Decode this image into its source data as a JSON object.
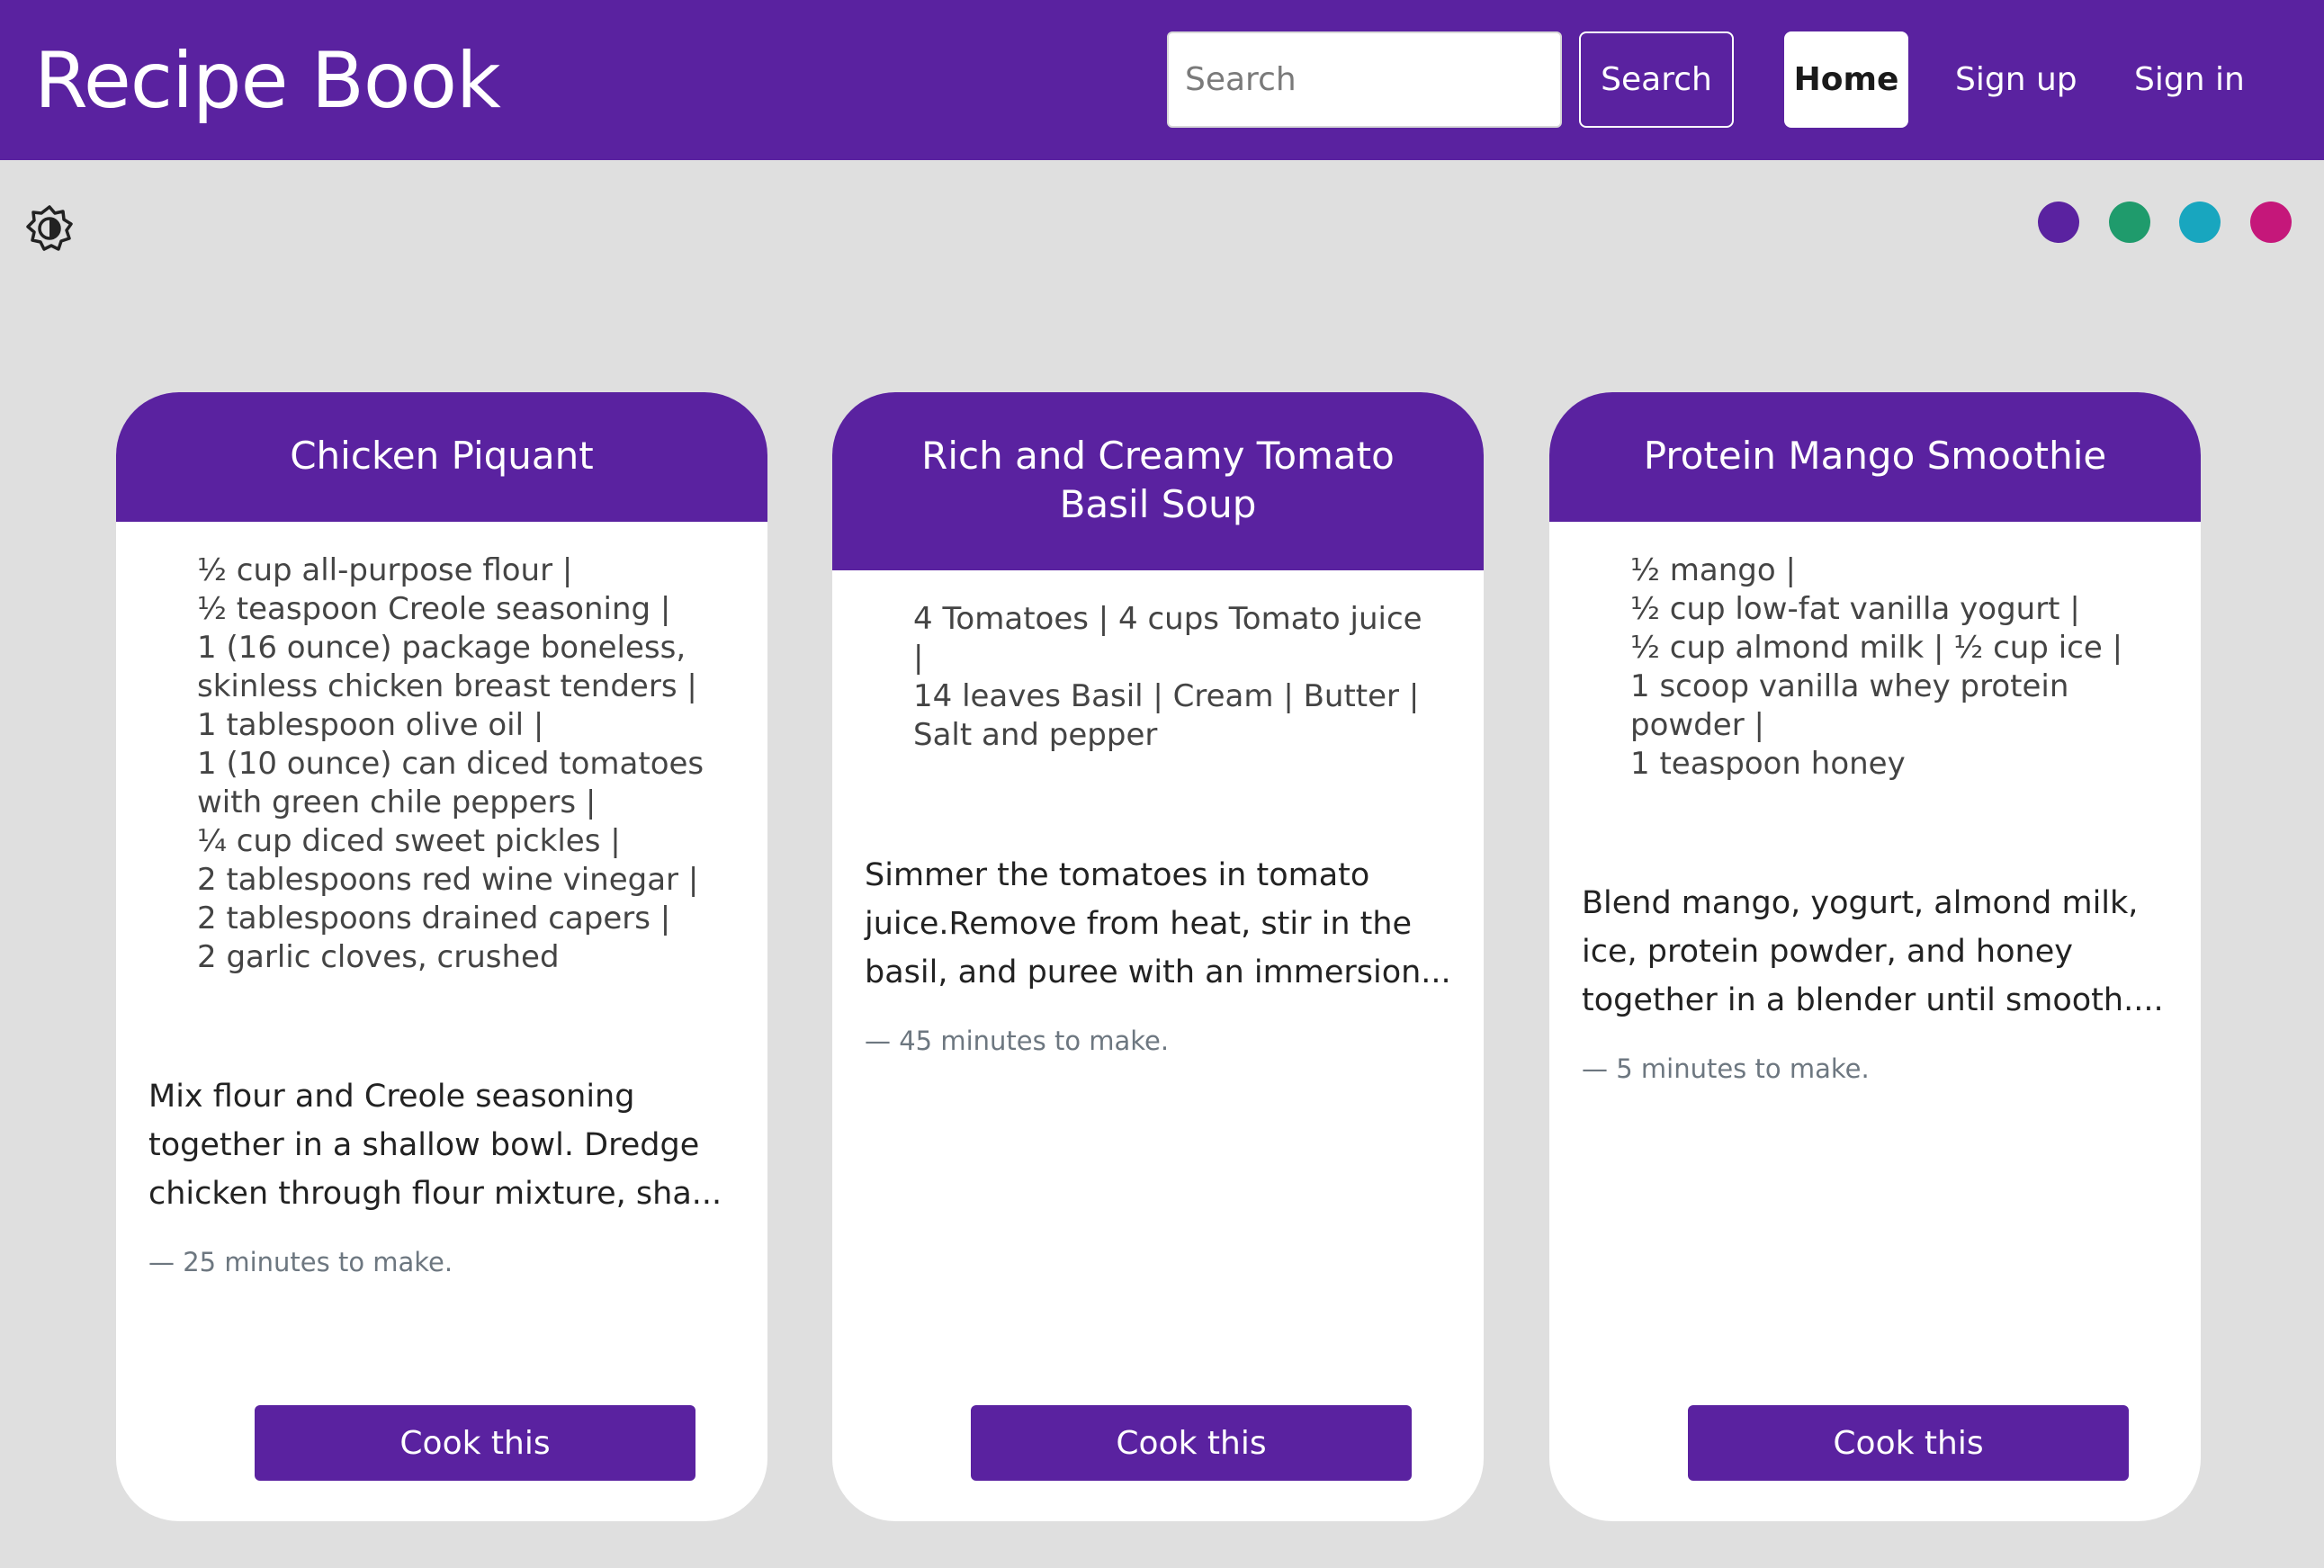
{
  "header": {
    "brand": "Recipe Book",
    "search_placeholder": "Search",
    "search_button": "Search",
    "nav": {
      "home": "Home",
      "signup": "Sign up",
      "signin": "Sign in"
    }
  },
  "theme": {
    "toggle_icon": "contrast-icon",
    "swatches": [
      {
        "name": "purple",
        "color": "#5a22a0"
      },
      {
        "name": "green",
        "color": "#1f9b6c"
      },
      {
        "name": "teal",
        "color": "#18a6bf"
      },
      {
        "name": "pink",
        "color": "#c5177a"
      }
    ]
  },
  "colors": {
    "primary": "#5a22a0",
    "background": "#dfdfdf"
  },
  "recipes": [
    {
      "title": "Chicken Piquant",
      "ingredients": [
        "½ cup all-purpose flour |",
        "½ teaspoon Creole seasoning |",
        "1 (16 ounce) package boneless,",
        "skinless chicken breast tenders |",
        "1 tablespoon olive oil |",
        "1 (10 ounce) can diced tomatoes",
        "with green chile peppers |",
        "¼ cup diced sweet pickles |",
        "2 tablespoons red wine vinegar |",
        "2 tablespoons drained capers |",
        "2 garlic cloves, crushed"
      ],
      "directions": "Mix flour and Creole seasoning together in a shallow bowl. Dredge chicken through flour mixture, sha...",
      "time": "— 25 minutes to make.",
      "button": "Cook this"
    },
    {
      "title": "Rich and Creamy Tomato Basil Soup",
      "ingredients": [
        "4 Tomatoes | 4 cups Tomato juice |",
        "14 leaves Basil | Cream | Butter |",
        "Salt and pepper"
      ],
      "directions": "Simmer the tomatoes in tomato juice.Remove from heat, stir in the basil, and puree with an immersion...",
      "time": "— 45 minutes to make.",
      "button": "Cook this"
    },
    {
      "title": "Protein Mango Smoothie",
      "ingredients": [
        "½ mango |",
        "½ cup low-fat vanilla yogurt |",
        "½ cup almond milk | ½ cup ice |",
        "1 scoop vanilla whey protein",
        "powder |",
        "1 teaspoon honey"
      ],
      "directions": "Blend mango, yogurt, almond milk, ice, protein powder, and honey together in a blender until smooth....",
      "time": "— 5 minutes to make.",
      "button": "Cook this"
    }
  ]
}
